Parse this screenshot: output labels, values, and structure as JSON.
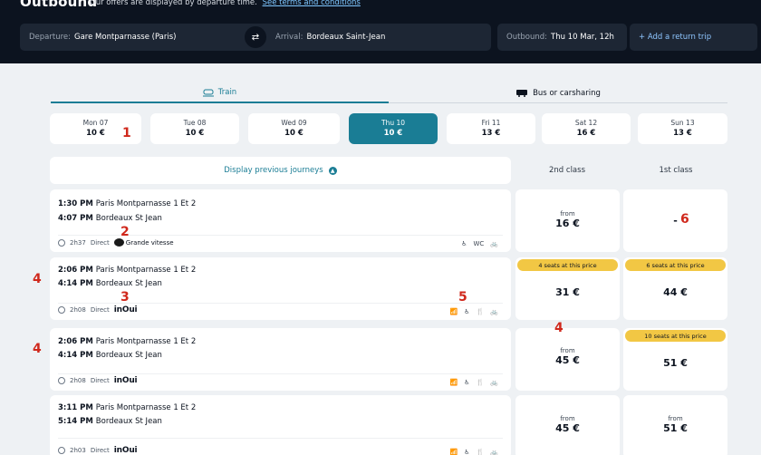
{
  "header": {
    "title": "Outbound",
    "subtitle": "Our offers are displayed by departure time.",
    "terms_link": "See terms and conditions",
    "departure_label": "Departure:",
    "departure_value": "Gare Montparnasse (Paris)",
    "arrival_label": "Arrival:",
    "arrival_value": "Bordeaux Saint-Jean",
    "outbound_label": "Outbound:",
    "outbound_value": "Thu 10 Mar, 12h",
    "return_label": "+ Add a return trip"
  },
  "tabs": {
    "train": "Train",
    "bus": "Bus or carsharing"
  },
  "dates": [
    {
      "day": "Mon 07",
      "price": "10 €"
    },
    {
      "day": "Tue 08",
      "price": "10 €"
    },
    {
      "day": "Wed 09",
      "price": "10 €"
    },
    {
      "day": "Thu 10",
      "price": "10 €"
    },
    {
      "day": "Fri 11",
      "price": "13 €"
    },
    {
      "day": "Sat 12",
      "price": "16 €"
    },
    {
      "day": "Sun 13",
      "price": "13 €"
    }
  ],
  "prev_journeys": "Display previous journeys",
  "class_headers": {
    "second": "2nd class",
    "first": "1st class"
  },
  "journeys": [
    {
      "dep_time": "1:30 PM",
      "dep_station": "Paris Montparnasse 1 Et 2",
      "arr_time": "4:07 PM",
      "arr_station": "Bordeaux St Jean",
      "duration": "2h37",
      "type": "Direct",
      "brand": "Grande vitesse",
      "amenities": [
        "♿",
        "WC",
        "🚲"
      ],
      "second": {
        "from": "from",
        "price": "16 €"
      },
      "first": {
        "price": "-"
      }
    },
    {
      "dep_time": "2:06 PM",
      "dep_station": "Paris Montparnasse 1 Et 2",
      "arr_time": "4:14 PM",
      "arr_station": "Bordeaux St Jean",
      "duration": "2h08",
      "type": "Direct",
      "brand": "inOui",
      "amenities": [
        "📶",
        "♿",
        "🍴",
        "🚲"
      ],
      "second": {
        "badge": "4 seats at this price",
        "price": "31 €"
      },
      "first": {
        "badge": "6 seats at this price",
        "price": "44 €"
      }
    },
    {
      "dep_time": "2:06 PM",
      "dep_station": "Paris Montparnasse 1 Et 2",
      "arr_time": "4:14 PM",
      "arr_station": "Bordeaux St Jean",
      "duration": "2h08",
      "type": "Direct",
      "brand": "inOui",
      "amenities": [
        "📶",
        "♿",
        "🍴",
        "🚲"
      ],
      "second": {
        "from": "from",
        "price": "45 €"
      },
      "first": {
        "badge": "10 seats at this price",
        "price": "51 €"
      }
    },
    {
      "dep_time": "3:11 PM",
      "dep_station": "Paris Montparnasse 1 Et 2",
      "arr_time": "5:14 PM",
      "arr_station": "Bordeaux St Jean",
      "duration": "2h03",
      "type": "Direct",
      "brand": "inOui",
      "amenities": [
        "📶",
        "♿",
        "🍴",
        "🚲"
      ],
      "second": {
        "from": "from",
        "price": "45 €"
      },
      "first": {
        "from": "from",
        "price": "51 €"
      }
    }
  ],
  "annotations": [
    "1",
    "2",
    "3",
    "4",
    "4",
    "4",
    "5",
    "6"
  ],
  "colors": {
    "accent": "#1a7d95",
    "header_bg": "#0c131f",
    "badge": "#f2c744",
    "annotation": "#d0281c"
  }
}
